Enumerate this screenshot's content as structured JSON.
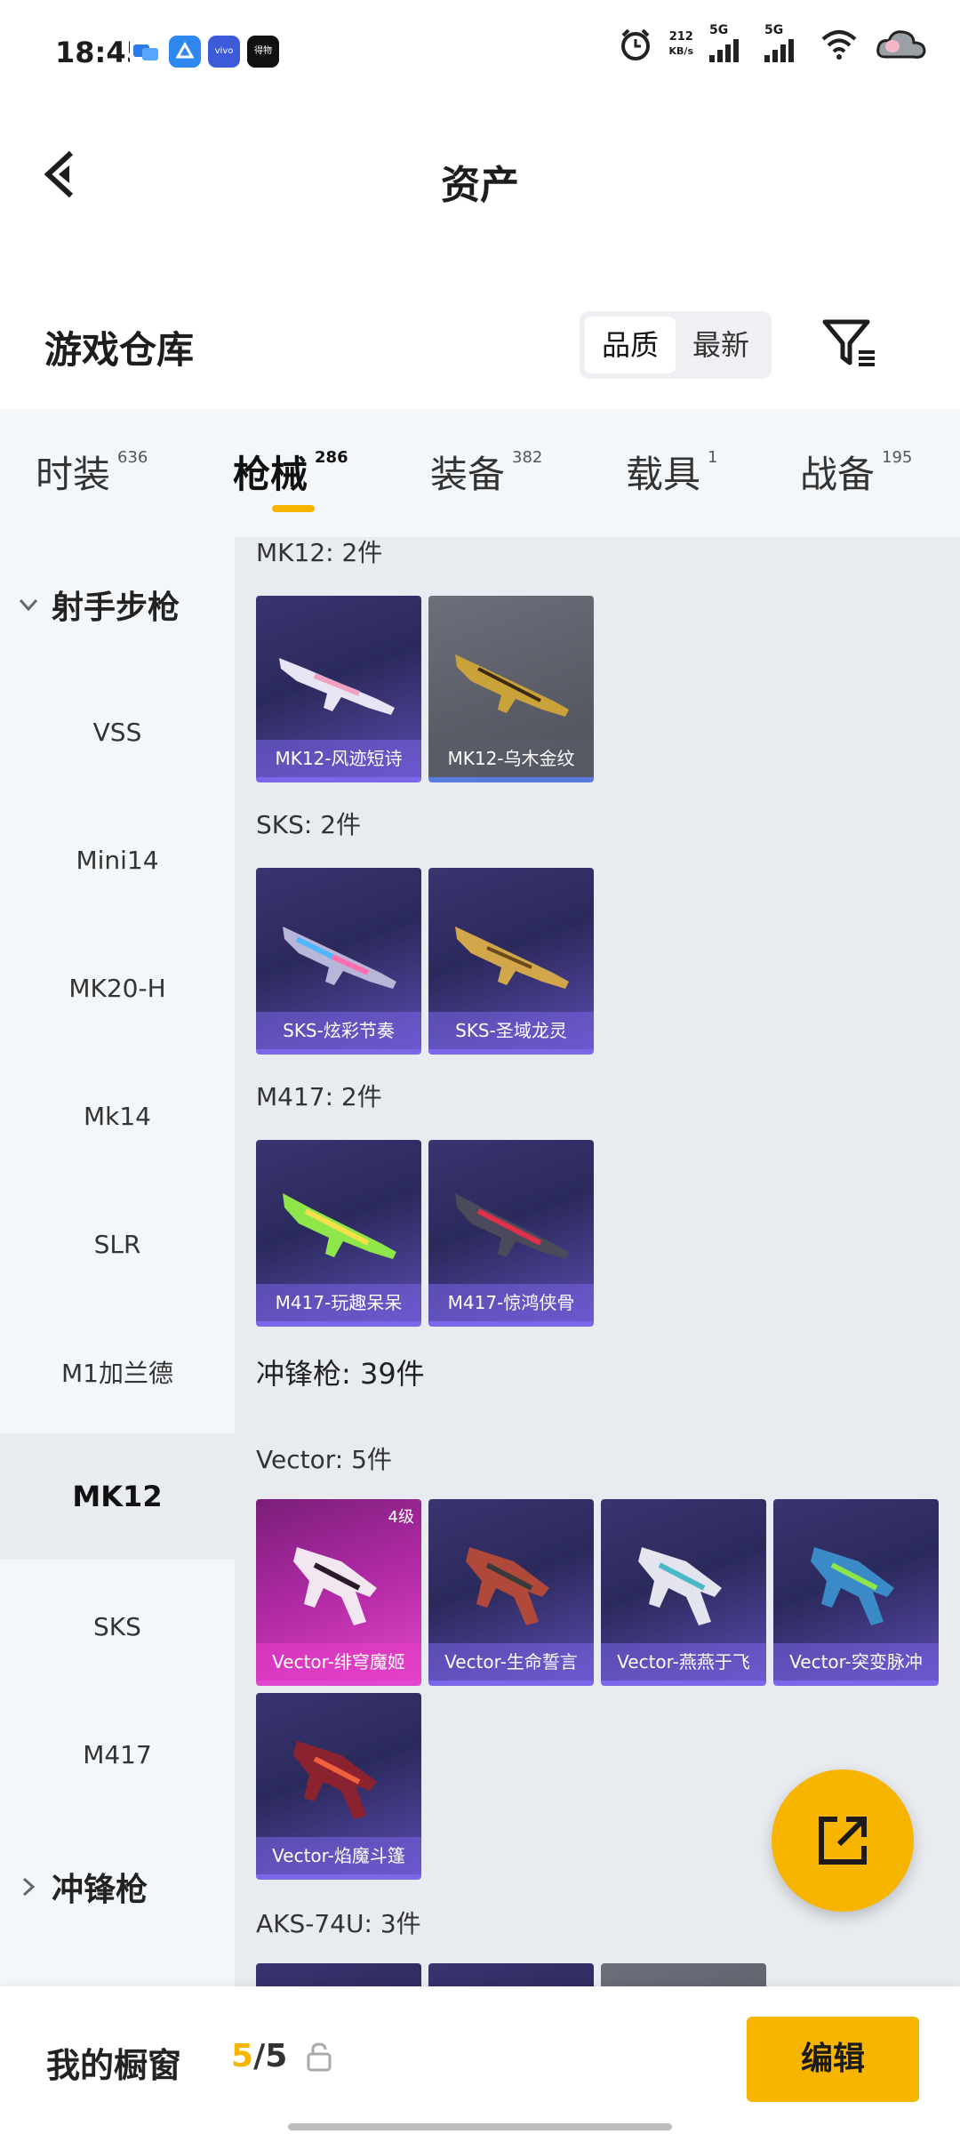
{
  "status_bar": {
    "time": "18:45",
    "net_speed_value": "212",
    "net_speed_unit": "KB/s",
    "signal1": "5G",
    "signal2": "5G",
    "app_icon_vivo": "vivo",
    "app_icon_news": "得物"
  },
  "header": {
    "title": "资产"
  },
  "section": {
    "title": "游戏仓库",
    "sort_options": [
      "品质",
      "最新"
    ]
  },
  "tabs": [
    {
      "label": "时装",
      "count": "636"
    },
    {
      "label": "枪械",
      "count": "286"
    },
    {
      "label": "装备",
      "count": "382"
    },
    {
      "label": "载具",
      "count": "1"
    },
    {
      "label": "战备",
      "count": "195"
    }
  ],
  "sidebar": {
    "group1": "射手步枪",
    "items": [
      "VSS",
      "Mini14",
      "MK20-H",
      "Mk14",
      "SLR",
      "M1加兰德",
      "MK12",
      "SKS",
      "M417"
    ],
    "group2": "冲锋枪"
  },
  "content": {
    "groups": [
      {
        "title": "MK12: 2件",
        "cards": [
          "MK12-风迹短诗",
          "MK12-乌木金纹"
        ]
      },
      {
        "title": "SKS: 2件",
        "cards": [
          "SKS-炫彩节奏",
          "SKS-圣域龙灵"
        ]
      },
      {
        "title": "M417: 2件",
        "cards": [
          "M417-玩趣呆呆",
          "M417-惊鸿侠骨"
        ]
      }
    ],
    "category": "冲锋枪: 39件",
    "vector": {
      "title": "Vector: 5件",
      "badge": "4级",
      "cards": [
        "Vector-绯穹魔姬",
        "Vector-生命誓言",
        "Vector-燕燕于飞",
        "Vector-突变脉冲",
        "Vector-焰魔斗篷"
      ]
    },
    "aks": {
      "title": "AKS-74U: 3件"
    }
  },
  "bottom": {
    "window_label": "我的橱窗",
    "count_current": "5",
    "count_total": "/5",
    "edit_label": "编辑"
  },
  "colors": {
    "accent": "#f7b500",
    "card_purple": "#3a3470",
    "card_pink": "#b62ba8"
  }
}
